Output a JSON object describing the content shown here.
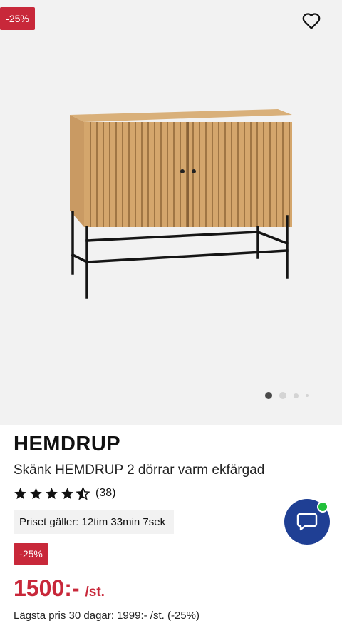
{
  "gallery": {
    "discount_badge": "-25%",
    "favorite_icon": "heart-icon",
    "product_image": "sideboard-image",
    "slide_count": 4,
    "active_slide": 1
  },
  "product": {
    "brand": "HEMDRUP",
    "subtitle": "Skänk HEMDRUP 2 dörrar varm ekfärgad",
    "rating": 4.5,
    "rating_max": 5,
    "rating_count": "(38)",
    "offer_timer": "Priset gäller: 12tim 33min 7sek",
    "discount_badge": "-25%",
    "price": "1500:-",
    "price_unit": "/st.",
    "lowest_price": "Lägsta pris 30 dagar: 1999:- /st. (-25%)"
  },
  "chat": {
    "icon": "chat-bubble-icon",
    "status": "online"
  },
  "colors": {
    "accent_red": "#c8283a",
    "chat_blue": "#1f3f94",
    "online_green": "#22c03a"
  }
}
